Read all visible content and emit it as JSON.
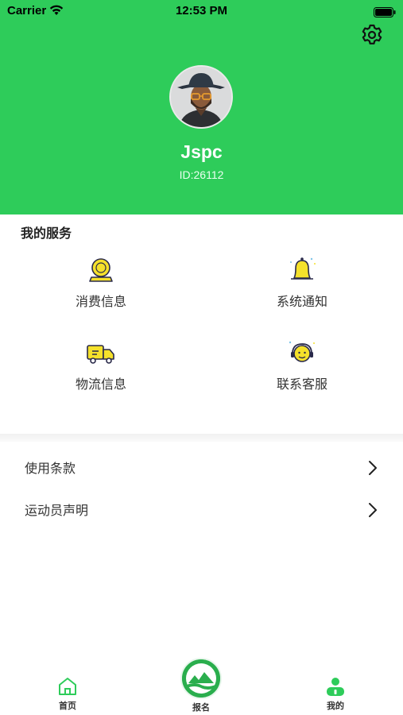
{
  "status_bar": {
    "carrier": "Carrier",
    "time": "12:53 PM"
  },
  "profile": {
    "name": "Jspc",
    "id_text": "ID:26112"
  },
  "services": {
    "title": "我的服务",
    "items": [
      {
        "label": "消费信息",
        "icon": "coin-icon"
      },
      {
        "label": "系统通知",
        "icon": "bell-icon"
      },
      {
        "label": "物流信息",
        "icon": "truck-icon"
      },
      {
        "label": "联系客服",
        "icon": "headset-icon"
      }
    ]
  },
  "list": [
    {
      "label": "使用条款"
    },
    {
      "label": "运动员声明"
    }
  ],
  "tabbar": {
    "tabs": [
      {
        "label": "首页",
        "icon": "home-icon"
      },
      {
        "label": "报名",
        "icon": "brand-logo-icon"
      },
      {
        "label": "我的",
        "icon": "person-icon"
      }
    ]
  },
  "colors": {
    "accent": "#2ecc5a",
    "icon_yellow": "#f5e12b"
  }
}
